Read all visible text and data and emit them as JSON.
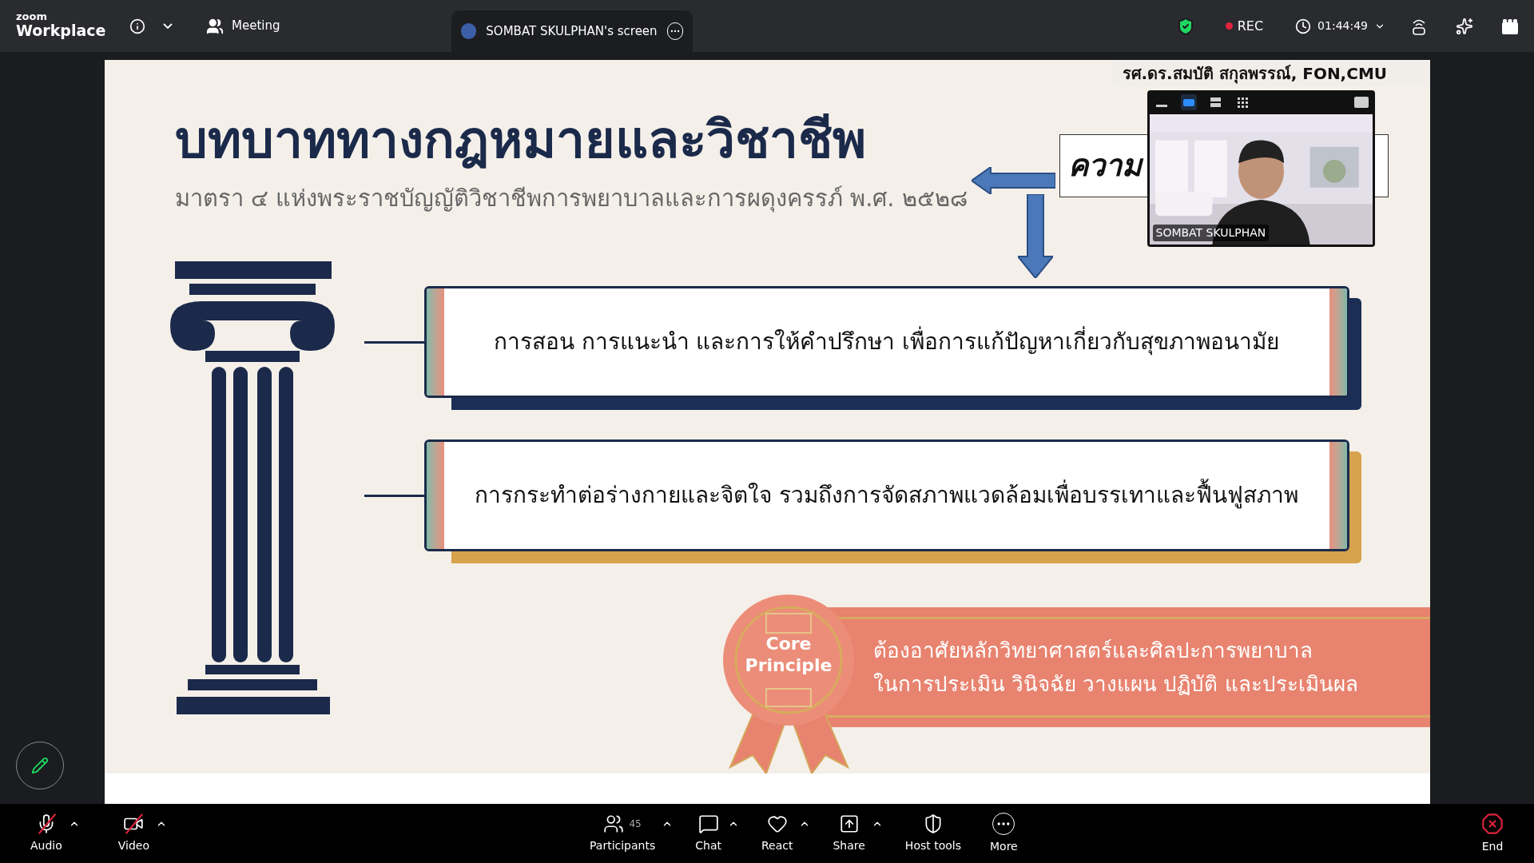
{
  "top_bar": {
    "brand_small": "zoom",
    "brand": "Workplace",
    "meeting_label": "Meeting",
    "share_tab": "SOMBAT SKULPHAN's screen",
    "rec": "REC",
    "timer": "01:44:49"
  },
  "slide": {
    "title": "บทบาททางกฎหมายและวิชาชีพ",
    "subtitle": "มาตรา ๔ แห่งพระราชบัญญัติวิชาชีพการพยาบาลและการผดุงครรภ์ พ.ศ. ๒๕๒๘",
    "callout": "ความ",
    "presenter_caption": "รศ.ดร.สมบัติ สกุลพรรณ์, FON,CMU",
    "roles": [
      {
        "text": "การสอน การแนะนำ และการให้คำปรึกษา เพื่อการแก้ปัญหาเกี่ยวกับสุขภาพอนามัย",
        "color": "#1b2f55"
      },
      {
        "text": "การกระทำต่อร่างกายและจิตใจ รวมถึงการจัดสภาพแวดล้อมเพื่อบรรเทาและฟื้นฟูสภาพ",
        "color": "#d7a24c"
      }
    ],
    "badge_lines": [
      "Core",
      "Principle"
    ],
    "principle_lines": [
      "ต้องอาศัยหลักวิทยาศาสตร์และศิลปะการพยาบาล",
      "ในการประเมิน วินิจฉัย วางแผน ปฏิบัติ และประเมินผล"
    ]
  },
  "video_tile": {
    "name": "SOMBAT SKULPHAN",
    "view_modes": [
      {
        "kind": "minimize",
        "selected": false
      },
      {
        "kind": "speaker",
        "selected": true
      },
      {
        "kind": "strip",
        "selected": false
      },
      {
        "kind": "grid",
        "selected": false
      }
    ]
  },
  "toolbar": [
    {
      "kind": "audio",
      "label": "Audio",
      "off": true,
      "menu": true
    },
    {
      "kind": "video",
      "label": "Video",
      "off": true,
      "menu": true
    },
    {
      "kind": "participants",
      "label": "Participants",
      "count": "45",
      "menu": true
    },
    {
      "kind": "chat",
      "label": "Chat",
      "menu": true
    },
    {
      "kind": "react",
      "label": "React",
      "menu": true
    },
    {
      "kind": "share",
      "label": "Share",
      "menu": true
    },
    {
      "kind": "host",
      "label": "Host tools",
      "menu": false
    },
    {
      "kind": "more",
      "label": "More",
      "menu": false
    },
    {
      "kind": "end",
      "label": "End",
      "menu": false
    }
  ]
}
